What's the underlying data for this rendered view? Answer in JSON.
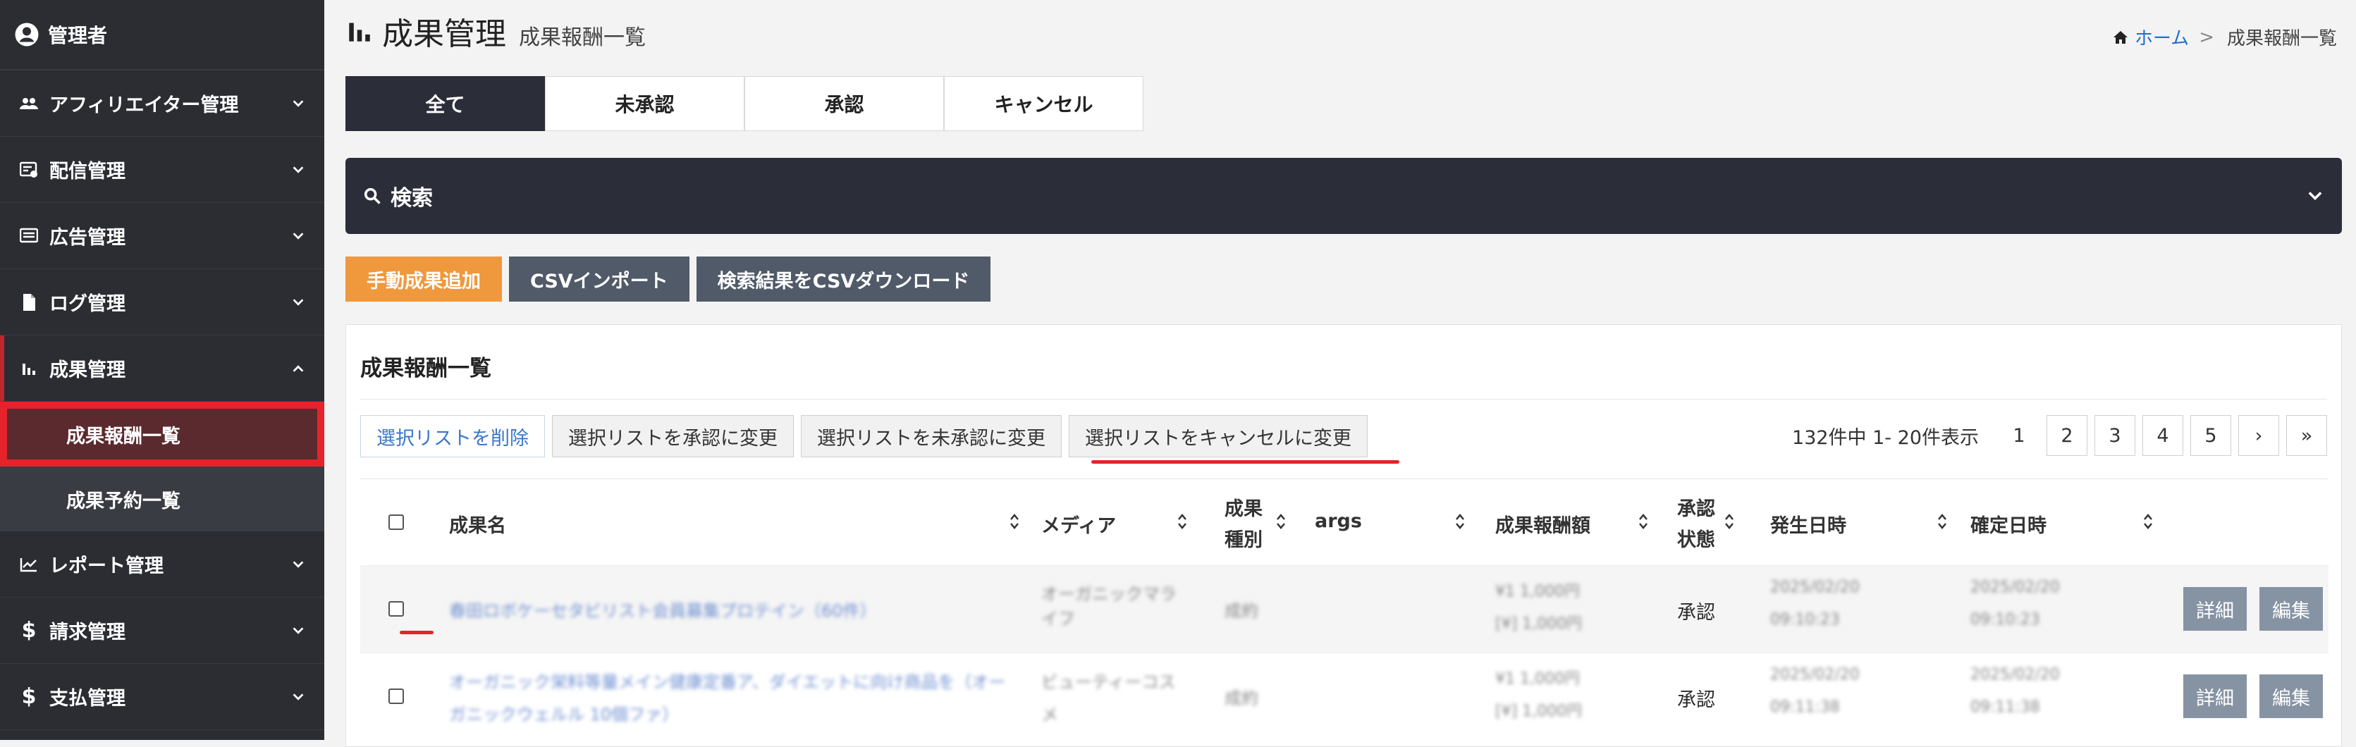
{
  "sidebar": {
    "admin_label": "管理者",
    "items": [
      {
        "label": "アフィリエイター管理",
        "icon": "users-icon"
      },
      {
        "label": "配信管理",
        "icon": "delivery-icon"
      },
      {
        "label": "広告管理",
        "icon": "ad-icon"
      },
      {
        "label": "ログ管理",
        "icon": "file-icon"
      },
      {
        "label": "成果管理",
        "icon": "bar-chart-icon"
      }
    ],
    "sub_items": [
      "成果報酬一覧",
      "成果予約一覧"
    ],
    "items_after": [
      {
        "label": "レポート管理",
        "icon": "line-chart-icon"
      },
      {
        "label": "請求管理",
        "icon": "dollar-icon"
      },
      {
        "label": "支払管理",
        "icon": "dollar-icon"
      }
    ]
  },
  "header": {
    "title": "成果管理",
    "subtitle": "成果報酬一覧"
  },
  "breadcrumb": {
    "home": "ホーム",
    "separator": ">",
    "current": "成果報酬一覧"
  },
  "tabs": [
    "全て",
    "未承認",
    "承認",
    "キャンセル"
  ],
  "search": {
    "label": "検索"
  },
  "actions": {
    "manual_add": "手動成果追加",
    "csv_import": "CSVインポート",
    "csv_download": "検索結果をCSVダウンロード"
  },
  "panel": {
    "title": "成果報酬一覧",
    "bulk": [
      "選択リストを削除",
      "選択リストを承認に変更",
      "選択リストを未承認に変更",
      "選択リストをキャンセルに変更"
    ],
    "pager": {
      "info": "132件中 1- 20件表示",
      "pages": [
        "1",
        "2",
        "3",
        "4",
        "5"
      ],
      "next": "›",
      "last": "»"
    }
  },
  "table": {
    "headers": {
      "name": "成果名",
      "media": "メディア",
      "type_line1": "成果",
      "type_line2": "種別",
      "args": "args",
      "amount": "成果報酬額",
      "status_line1": "承認",
      "status_line2": "状態",
      "occurred": "発生日時",
      "confirmed": "確定日時"
    },
    "rows": [
      {
        "name": "春田ロボケーセタビリスト会員募集プロテイン（60件）",
        "media": "オーガニックマライフ",
        "type": "成約",
        "amount_l1": "¥1   1,000円",
        "amount_l2": "[¥]   1,000円",
        "status": "承認",
        "occurred_l1": "2025/02/20",
        "occurred_l2": "09:10:23",
        "confirmed_l1": "2025/02/20",
        "confirmed_l2": "09:10:23",
        "detail": "詳細",
        "edit": "編集"
      },
      {
        "name": "オーガニック栄料等量メイン健康定番ア、ダイエットに向け商品を（オーガニックウェルル 10個ファ）",
        "media": "ビューティーコスメ",
        "type": "成約",
        "amount_l1": "¥1   1,000円",
        "amount_l2": "[¥]   1,000円",
        "status": "承認",
        "occurred_l1": "2025/02/20",
        "occurred_l2": "09:11:38",
        "confirmed_l1": "2025/02/20",
        "confirmed_l2": "09:11:38",
        "detail": "詳細",
        "edit": "編集"
      }
    ]
  },
  "colors": {
    "sidebar_bg": "#2b2d33",
    "active_red": "#e5232b",
    "accent_orange": "#f0983c",
    "dark_button": "#505a68",
    "link_blue": "#1f6fd1"
  }
}
